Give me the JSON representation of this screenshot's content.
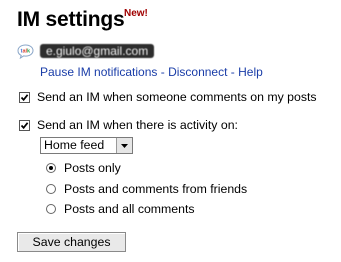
{
  "header": {
    "title": "IM settings",
    "badge": "New!"
  },
  "account": {
    "email": "e.giulo@gmail.com",
    "icon": "gtalk-icon"
  },
  "links": {
    "pause": "Pause IM notifications",
    "disconnect": "Disconnect",
    "help": "Help",
    "separator": " - "
  },
  "options": {
    "comments_label": "Send an IM when someone comments on my posts",
    "comments_checked": true,
    "activity_label": "Send an IM when there is activity on:",
    "activity_checked": true
  },
  "feed_select": {
    "selected": "Home feed"
  },
  "radios": [
    {
      "label": "Posts only",
      "checked": true
    },
    {
      "label": "Posts and comments from friends",
      "checked": false
    },
    {
      "label": "Posts and all comments",
      "checked": false
    }
  ],
  "actions": {
    "save_label": "Save changes"
  },
  "colors": {
    "link": "#1a3da8",
    "badge": "#a00000"
  }
}
